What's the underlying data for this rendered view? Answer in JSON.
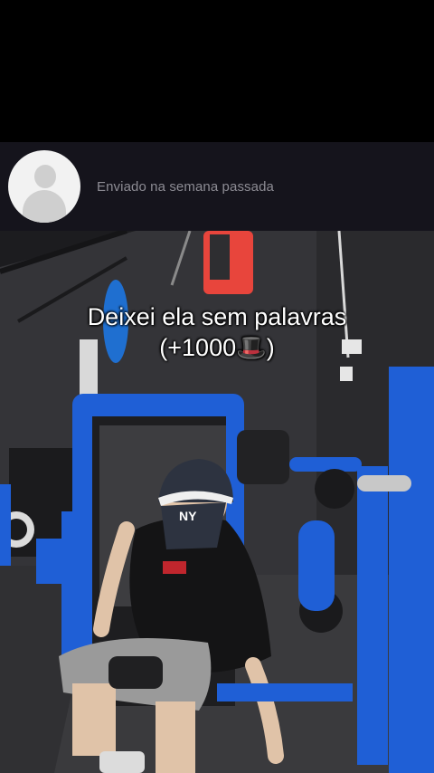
{
  "message": {
    "status_text": "Enviado na semana passada",
    "avatar_icon": "default-user-avatar-icon"
  },
  "video": {
    "caption_line1": "Deixei ela sem palavras",
    "caption_line2": "(+1000🎩)"
  },
  "colors": {
    "bar_bg": "#15141c",
    "machine_blue": "#1f5fd6",
    "accent_red": "#e8453c"
  }
}
